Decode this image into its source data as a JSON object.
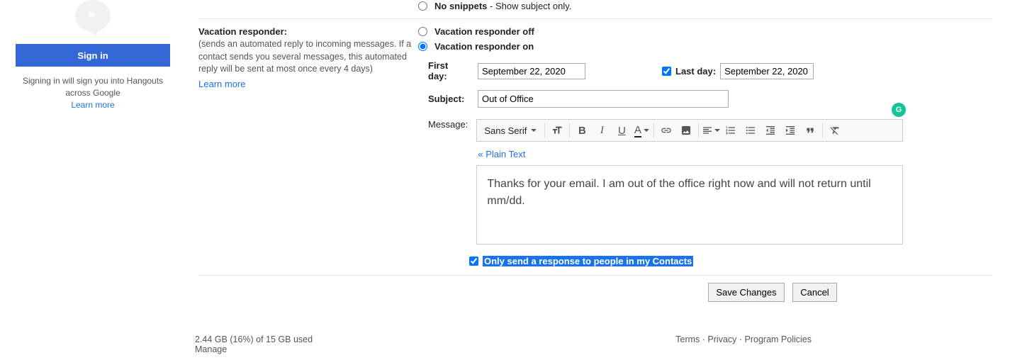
{
  "sidebar": {
    "signin_label": "Sign in",
    "signin_text": "Signing in will sign you into Hangouts across Google",
    "learn_more": "Learn more"
  },
  "snippets": {
    "no_snippets_label": "No snippets",
    "no_snippets_desc": " - Show subject only."
  },
  "vacation": {
    "title": "Vacation responder:",
    "desc": "(sends an automated reply to incoming messages. If a contact sends you several messages, this automated reply will be sent at most once every 4 days)",
    "learn_more": "Learn more",
    "off_label": "Vacation responder off",
    "on_label": "Vacation responder on",
    "first_day_label": "First day:",
    "first_day_value": "September 22, 2020",
    "last_day_label": "Last day:",
    "last_day_value": "September 22, 2020",
    "subject_label": "Subject:",
    "subject_value": "Out of Office",
    "message_label": "Message:",
    "font_name": "Sans Serif",
    "plain_text": "« Plain Text",
    "message_body": "Thanks for your email. I am out of the office right now and will not return until mm/dd.",
    "contacts_only": "Only send a response to people in my Contacts"
  },
  "buttons": {
    "save": "Save Changes",
    "cancel": "Cancel"
  },
  "footer": {
    "storage": "2.44 GB (16%) of 15 GB used",
    "manage": "Manage",
    "terms": "Terms",
    "privacy": "Privacy",
    "policies": "Program Policies"
  },
  "grammarly_badge": "G"
}
